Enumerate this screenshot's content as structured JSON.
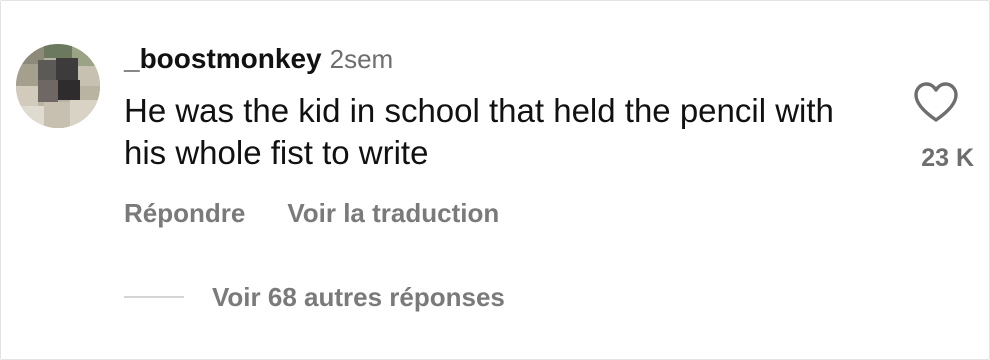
{
  "comment": {
    "username": "_boostmonkey",
    "time": "2sem",
    "text": "He was the kid in school that held the pencil with his whole fist to write",
    "like_icon": "heart-outline-icon",
    "like_count": "23 K"
  },
  "actions": {
    "reply_label": "Répondre",
    "translate_label": "Voir la traduction"
  },
  "replies": {
    "label": "Voir 68 autres réponses"
  },
  "colors": {
    "text": "#111111",
    "muted": "#7a7a7a",
    "divider": "#d4d4d4"
  }
}
